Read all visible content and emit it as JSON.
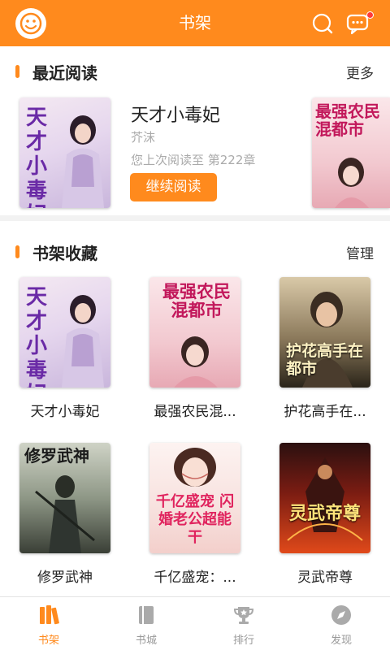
{
  "header": {
    "title": "书架",
    "avatar_icon": "smiley-face-icon",
    "search_icon": "search-icon",
    "message_icon": "chat-bubble-icon",
    "accent": "#ff8a1d"
  },
  "recent": {
    "section_title": "最近阅读",
    "more_label": "更多",
    "book": {
      "title": "天才小毒妃",
      "author": "芥沫",
      "progress": "您上次阅读至 第222章",
      "continue_label": "继续阅读",
      "cover_text": "天才小毒妃"
    },
    "next_cover_text": "最强农民混都市"
  },
  "shelf": {
    "section_title": "书架收藏",
    "manage_label": "管理",
    "books": [
      {
        "title": "天才小毒妃",
        "cover_text": "天才小毒妃"
      },
      {
        "title": "最强农民混...",
        "cover_text": "最强农民混都市"
      },
      {
        "title": "护花高手在...",
        "cover_text": "护花高手在都市"
      },
      {
        "title": "修罗武神",
        "cover_text": "修罗武神"
      },
      {
        "title": "千亿盛宠：...",
        "cover_text": "千亿盛宠 闪婚老公超能干"
      },
      {
        "title": "灵武帝尊",
        "cover_text": "灵武帝尊"
      }
    ]
  },
  "tabs": [
    {
      "label": "书架",
      "icon": "bookshelf-icon",
      "active": true
    },
    {
      "label": "书城",
      "icon": "book-icon",
      "active": false
    },
    {
      "label": "排行",
      "icon": "trophy-icon",
      "active": false
    },
    {
      "label": "发现",
      "icon": "compass-icon",
      "active": false
    }
  ]
}
